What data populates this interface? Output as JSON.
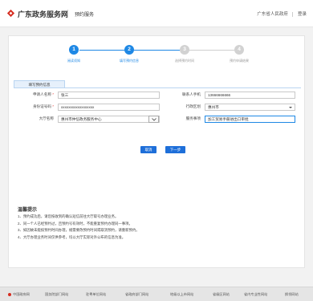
{
  "header": {
    "brand": "广东政务服务网",
    "subtitle": "预约服务",
    "region_link": "广东省人民政府",
    "login_link": "登录",
    "brand_color": "#d62d20"
  },
  "steps": [
    {
      "num": "1",
      "label": "阅读须知",
      "state": "done"
    },
    {
      "num": "2",
      "label": "填写预约信息",
      "state": "active"
    },
    {
      "num": "3",
      "label": "选择预约时间",
      "state": "pending"
    },
    {
      "num": "4",
      "label": "预约申请结果",
      "state": "pending"
    }
  ],
  "tab": {
    "label": "填写预约信息"
  },
  "form": {
    "name_label": "申请人名称",
    "name_value": "张三",
    "id_label": "身份证号码",
    "id_value": "xxxxxxxxxxxxxxxxxx",
    "hall_label": "大厅名称",
    "hall_value": "惠州市仲恺政务服务中心",
    "phone_label": "联系人手机",
    "phone_value": "13666666666",
    "district_label": "行政区划",
    "district_value": "惠州市",
    "service_label": "服务事项",
    "service_value": "加工贸易手册进出口审批"
  },
  "buttons": {
    "cancel": "取消",
    "next": "下一步"
  },
  "tips": {
    "title": "温馨提示",
    "items": [
      "1、预约成功后，请您按收到的确认短信前往大厅取号办理业务。",
      "2、同一个人已经预约过，且预约号有效时，不能重复预约办理同一事项。",
      "3、如因故未能按预约时间办理，规需要改预约时间或取消预约，请重新预约。",
      "4、大厅办理业务时间仅供参考，均以大厅实际对外公布的信息为准。"
    ]
  },
  "footer": {
    "items": [
      "中国政府网",
      "国务院部门网站",
      "驻粤单位网站",
      "省政府部门网站",
      "地级以上市网站",
      "省级区网站",
      "省内专业性网站",
      "换领网站"
    ]
  }
}
